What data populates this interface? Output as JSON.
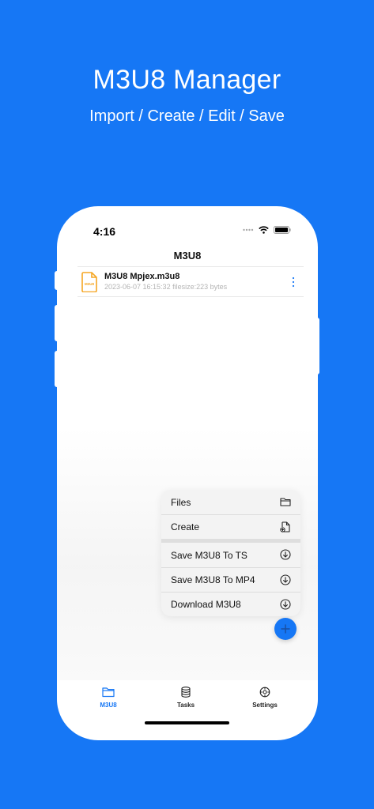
{
  "hero": {
    "title": "M3U8 Manager",
    "subtitle": "Import / Create / Edit / Save"
  },
  "status_bar": {
    "time": "4:16"
  },
  "nav": {
    "title": "M3U8"
  },
  "files": [
    {
      "name": "M3U8 Mpjex.m3u8",
      "meta": "2023-06-07 16:15:32 filesize:223 bytes",
      "icon_label": "M3U8",
      "icon": "m3u8-file-icon"
    }
  ],
  "menu": {
    "items": [
      {
        "label": "Files",
        "icon": "folder-icon"
      },
      {
        "label": "Create",
        "icon": "new-file-icon"
      },
      {
        "label": "Save M3U8 To TS",
        "icon": "download-circle-icon"
      },
      {
        "label": "Save M3U8 To MP4",
        "icon": "download-circle-icon"
      },
      {
        "label": "Download M3U8",
        "icon": "download-circle-icon"
      }
    ]
  },
  "tabs": [
    {
      "label": "M3U8",
      "icon": "folder-icon",
      "active": true
    },
    {
      "label": "Tasks",
      "icon": "database-icon",
      "active": false
    },
    {
      "label": "Settings",
      "icon": "settings-icon",
      "active": false
    }
  ],
  "colors": {
    "brand_blue": "#1677f5",
    "file_icon_orange": "#f5a623"
  }
}
